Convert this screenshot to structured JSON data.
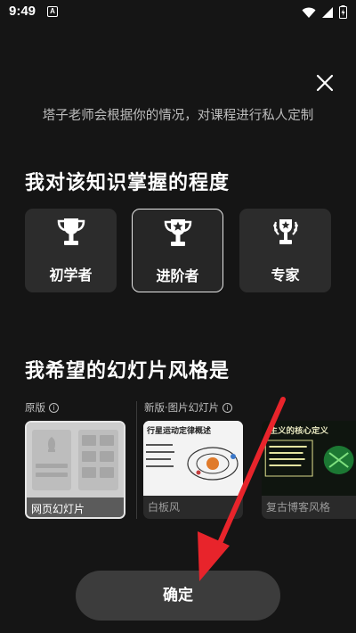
{
  "status_bar": {
    "time": "9:49",
    "notification_letter": "A"
  },
  "subtitle": "塔子老师会根据你的情况，对课程进行私人定制",
  "level_section": {
    "title": "我对该知识掌握的程度",
    "options": [
      {
        "label": "初学者",
        "icon": "trophy-icon",
        "selected": false
      },
      {
        "label": "进阶者",
        "icon": "star-trophy-icon",
        "selected": true
      },
      {
        "label": "专家",
        "icon": "laurel-trophy-icon",
        "selected": false
      }
    ]
  },
  "style_section": {
    "title": "我希望的幻灯片风格是",
    "categories": {
      "original": "原版",
      "new": "新版·图片幻灯片"
    },
    "options": [
      {
        "name": "网页幻灯片",
        "selected": true
      },
      {
        "name": "白板风",
        "selected": false,
        "thumb_title": "行星运动定律概述"
      },
      {
        "name": "复古博客风格",
        "selected": false,
        "thumb_title": "主义的核心定义"
      }
    ]
  },
  "confirm_label": "确定",
  "colors": {
    "background": "#151515",
    "card": "#2c2c2c",
    "button": "#3c3c3c",
    "arrow": "#e8242b"
  }
}
